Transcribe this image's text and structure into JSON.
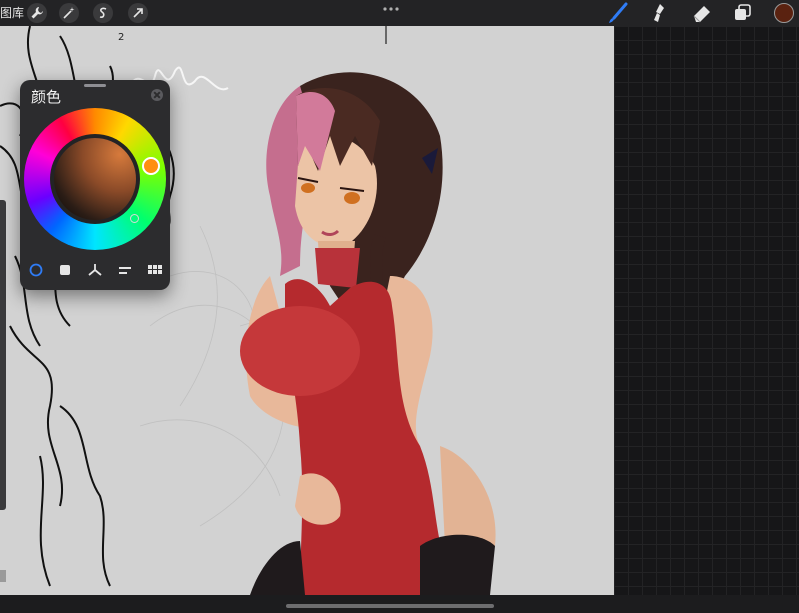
{
  "toolbar": {
    "gallery_label": "图库",
    "left_tools": [
      "wrench-icon",
      "magic-wand-icon",
      "selection-icon",
      "transform-arrow-icon"
    ],
    "more_icon": "more-dots-icon",
    "right_tools": [
      "brush-icon",
      "smudge-icon",
      "eraser-icon",
      "layers-icon"
    ],
    "current_color": "#5a2210",
    "brush_accent": "#2f7cf6"
  },
  "color_panel": {
    "title": "颜色",
    "mode": "disc",
    "tabs": [
      "disc-mode-icon",
      "classic-mode-icon",
      "harmony-mode-icon",
      "value-mode-icon",
      "palettes-mode-icon"
    ],
    "active_tab": 0,
    "selected_hue": "#ff8f10",
    "selected_color": "#2b1d16"
  },
  "canvas": {
    "background": "#d2d2d2",
    "artwork": "digital-illustration",
    "handwriting": "2"
  }
}
